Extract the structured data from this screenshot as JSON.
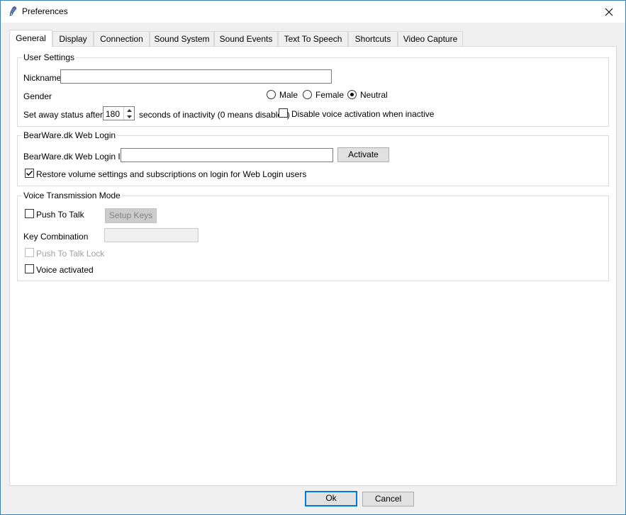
{
  "window": {
    "title": "Preferences"
  },
  "tabs": [
    {
      "label": "General"
    },
    {
      "label": "Display"
    },
    {
      "label": "Connection"
    },
    {
      "label": "Sound System"
    },
    {
      "label": "Sound Events"
    },
    {
      "label": "Text To Speech"
    },
    {
      "label": "Shortcuts"
    },
    {
      "label": "Video Capture"
    }
  ],
  "user_settings": {
    "title": "User Settings",
    "nickname_label": "Nickname",
    "nickname_value": "",
    "gender_label": "Gender",
    "gender_options": [
      "Male",
      "Female",
      "Neutral"
    ],
    "gender_selected": "Neutral",
    "away_label": "Set away status after",
    "away_value": "180",
    "away_suffix": "seconds of inactivity (0 means disabled)",
    "disable_voice_label": "Disable voice activation when inactive",
    "disable_voice_checked": false
  },
  "web_login": {
    "title": "BearWare.dk Web Login",
    "id_label": "BearWare.dk Web Login ID",
    "id_value": "",
    "activate_label": "Activate",
    "restore_label": "Restore volume settings and subscriptions on login for Web Login users",
    "restore_checked": true
  },
  "voice_mode": {
    "title": "Voice Transmission Mode",
    "ptt_label": "Push To Talk",
    "ptt_checked": false,
    "setup_keys_label": "Setup Keys",
    "key_combo_label": "Key Combination",
    "key_combo_value": "",
    "ptt_lock_label": "Push To Talk Lock",
    "voice_activated_label": "Voice activated",
    "voice_activated_checked": false
  },
  "footer": {
    "ok_label": "Ok",
    "cancel_label": "Cancel"
  },
  "colors": {
    "accent": "#0078d7",
    "border": "#dcdcdc"
  }
}
